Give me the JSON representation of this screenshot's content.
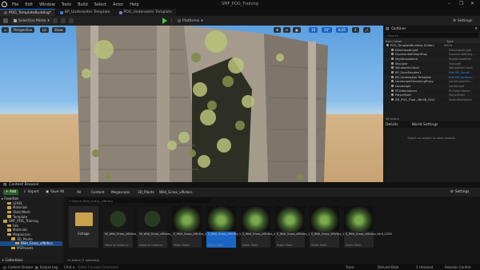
{
  "window": {
    "title": "SMF_POG_Training",
    "menu": [
      "File",
      "Edit",
      "Window",
      "Tools",
      "Build",
      "Select",
      "Actor",
      "Help"
    ],
    "controls": [
      "–",
      "❐",
      "✕"
    ]
  },
  "tabs": [
    {
      "label": "POG_TemplateBuilding*"
    },
    {
      "label": "BP_Underwater Template"
    },
    {
      "label": "POG_Underwater Template"
    }
  ],
  "toolbar": {
    "selection_mode": "Selection Mode",
    "platforms": "Platforms",
    "settings": "Settings"
  },
  "viewport": {
    "buttons": [
      "Perspective",
      "Lit",
      "Show"
    ],
    "right_numbers": [
      "10",
      "10°",
      "0.25",
      "4"
    ]
  },
  "outliner": {
    "title": "Outliner",
    "search_placeholder": "Search...",
    "col_item": "Item Label",
    "col_type": "Type",
    "rows": [
      {
        "name": "POG_TemplateBuilding (Editor)",
        "type": "World"
      },
      {
        "name": "DirectionalLight",
        "type": "DirectionalLight"
      },
      {
        "name": "ExponentialHeightFog",
        "type": "ExponentialHeig..."
      },
      {
        "name": "SkyAtmosphere",
        "type": "SkyAtmosphere"
      },
      {
        "name": "SkyLight",
        "type": "SkyLight"
      },
      {
        "name": "VolumetricCloud",
        "type": "VolumetricCloud"
      },
      {
        "name": "BP_ZoneEmpties1",
        "type": "Edit BP_ZoneE..."
      },
      {
        "name": "BP_Underwater Template",
        "type": "Edit BP_Underw..."
      },
      {
        "name": "LandscapeStreamingProxy",
        "type": "LandscapeStre..."
      },
      {
        "name": "Landscape",
        "type": "Landscape"
      },
      {
        "name": "PCGWorldActor",
        "type": "PCGWorldActor"
      },
      {
        "name": "PlayerStart",
        "type": "PlayerStart"
      },
      {
        "name": "SM_POG_Floor_3Bx3B_02s1",
        "type": "StaticMeshActor"
      }
    ],
    "footer": "56 actors"
  },
  "details": {
    "tab1": "Details",
    "tab2": "World Settings",
    "empty": "Select an object to view details."
  },
  "content_browser": {
    "title": "Content Browser",
    "add": "+ Add",
    "import": "Import",
    "save_all": "Save All",
    "breadcrumb": [
      "All",
      "Content",
      "Megascans",
      "3D_Plants",
      "Wild_Grass_vlfkrbcs"
    ],
    "settings": "Settings",
    "search_placeholder": "Search Wild_Grass_vlfkrbcs",
    "favorites_label": "Favorites",
    "tree": [
      {
        "label": "LEVEL",
        "indent": 1
      },
      {
        "label": "Materials",
        "indent": 1
      },
      {
        "label": "StaticMesh",
        "indent": 1
      },
      {
        "label": "Template",
        "indent": 1
      },
      {
        "label": "SMF_POG_Training",
        "indent": 0
      },
      {
        "label": "Fab",
        "indent": 1
      },
      {
        "label": "Materials",
        "indent": 1
      },
      {
        "label": "Megascans",
        "indent": 1
      },
      {
        "label": "3D_Plants",
        "indent": 2
      },
      {
        "label": "Wild_Grass_vlfkrbcs",
        "indent": 3,
        "selected": true
      },
      {
        "label": "MSPresets",
        "indent": 2
      }
    ],
    "collections": "Collections",
    "assets": [
      {
        "name": "Foliage",
        "type": "",
        "kind": "folder"
      },
      {
        "name": "MI_Wild_Grass_vlfkrbcs_2K",
        "type": "Material Instance",
        "kind": "mat"
      },
      {
        "name": "MI_Wild_Grass_vlfkrbcs_Billboard_2K",
        "type": "Material Instance",
        "kind": "mat"
      },
      {
        "name": "S_Wild_Grass_vlfkrbcs_Var1_LOD0",
        "type": "Static Mesh",
        "kind": "mesh"
      },
      {
        "name": "S_Wild_Grass_vlfkrbcs_Var2_LOD0",
        "type": "Static Mesh",
        "kind": "mesh",
        "selected": true
      },
      {
        "name": "S_Wild_Grass_vlfkrbcs_Var3_LOD0",
        "type": "Static Mesh",
        "kind": "mesh"
      },
      {
        "name": "S_Wild_Grass_vlfkrbcs_Var4_LOD0",
        "type": "Static Mesh",
        "kind": "mesh"
      },
      {
        "name": "S_Wild_Grass_vlfkrbcs_Var5_LOD0",
        "type": "Static Mesh",
        "kind": "mesh"
      },
      {
        "name": "S_Wild_Grass_vlfkrbcs_Var6_LOD0",
        "type": "Static Mesh",
        "kind": "mesh"
      }
    ],
    "count": "10 items (1 selected)"
  },
  "statusbar": {
    "drawer": "Content Drawer",
    "output": "Output Log",
    "cmd": "Cmd",
    "console_placeholder": "Enter Console Command",
    "trace": "Trace",
    "derived": "Derived Data",
    "unsaved": "2 Unsaved",
    "revision": "Revision Control"
  },
  "colors": {
    "accent": "#1a65c4",
    "play": "#4bbf45",
    "folder": "#c9a24e"
  }
}
